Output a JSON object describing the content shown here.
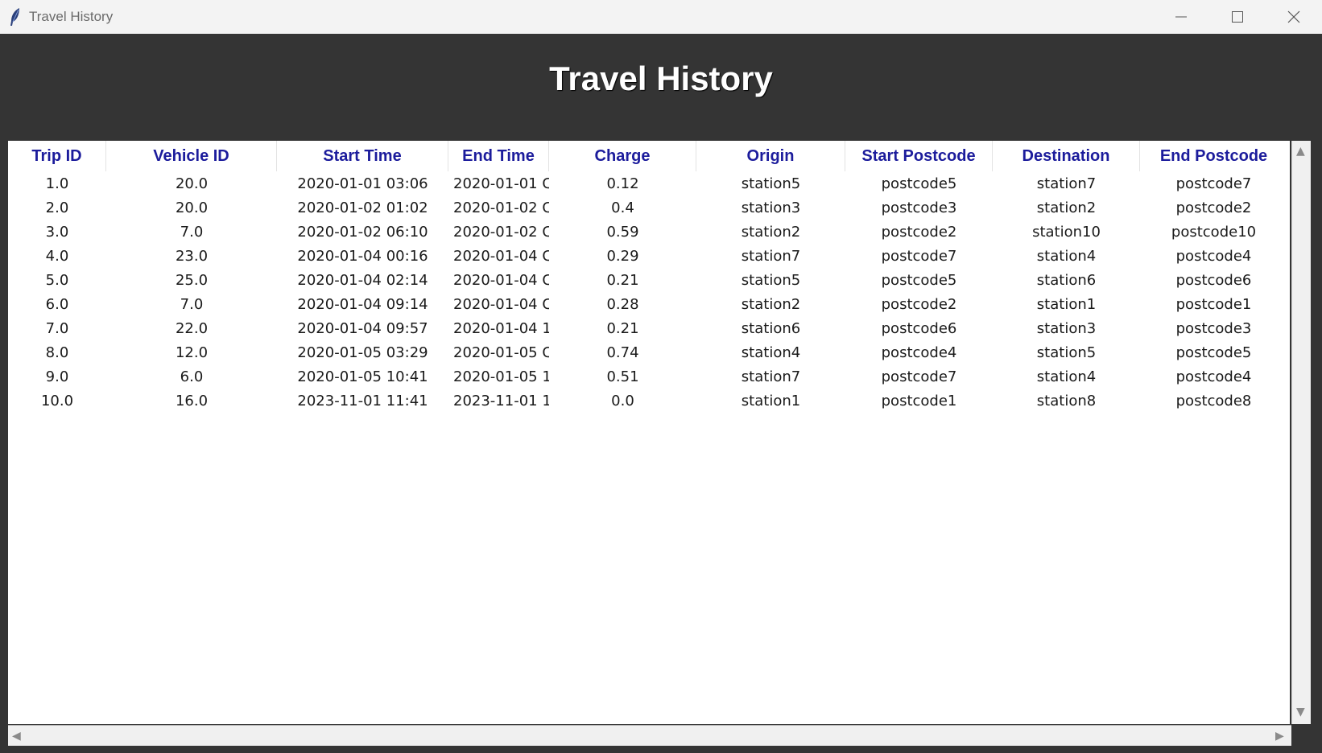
{
  "window": {
    "title": "Travel History",
    "icon": "feather-icon"
  },
  "heading": "Travel History",
  "table": {
    "columns": [
      "Trip ID",
      "Vehicle ID",
      "Start Time",
      "End Time",
      "Charge",
      "Origin",
      "Start Postcode",
      "Destination",
      "End Postcode"
    ],
    "rows": [
      [
        "1.0",
        "20.0",
        "2020-01-01 03:06",
        "2020-01-01 C",
        "0.12",
        "station5",
        "postcode5",
        "station7",
        "postcode7"
      ],
      [
        "2.0",
        "20.0",
        "2020-01-02 01:02",
        "2020-01-02 C",
        "0.4",
        "station3",
        "postcode3",
        "station2",
        "postcode2"
      ],
      [
        "3.0",
        "7.0",
        "2020-01-02 06:10",
        "2020-01-02 C",
        "0.59",
        "station2",
        "postcode2",
        "station10",
        "postcode10"
      ],
      [
        "4.0",
        "23.0",
        "2020-01-04 00:16",
        "2020-01-04 C",
        "0.29",
        "station7",
        "postcode7",
        "station4",
        "postcode4"
      ],
      [
        "5.0",
        "25.0",
        "2020-01-04 02:14",
        "2020-01-04 C",
        "0.21",
        "station5",
        "postcode5",
        "station6",
        "postcode6"
      ],
      [
        "6.0",
        "7.0",
        "2020-01-04 09:14",
        "2020-01-04 C",
        "0.28",
        "station2",
        "postcode2",
        "station1",
        "postcode1"
      ],
      [
        "7.0",
        "22.0",
        "2020-01-04 09:57",
        "2020-01-04 1",
        "0.21",
        "station6",
        "postcode6",
        "station3",
        "postcode3"
      ],
      [
        "8.0",
        "12.0",
        "2020-01-05 03:29",
        "2020-01-05 C",
        "0.74",
        "station4",
        "postcode4",
        "station5",
        "postcode5"
      ],
      [
        "9.0",
        "6.0",
        "2020-01-05 10:41",
        "2020-01-05 1",
        "0.51",
        "station7",
        "postcode7",
        "station4",
        "postcode4"
      ],
      [
        "10.0",
        "16.0",
        "2023-11-01 11:41",
        "2023-11-01 1",
        "0.0",
        "station1",
        "postcode1",
        "station8",
        "postcode8"
      ]
    ]
  },
  "colors": {
    "background": "#343434",
    "header_text": "#1c1c9c"
  }
}
